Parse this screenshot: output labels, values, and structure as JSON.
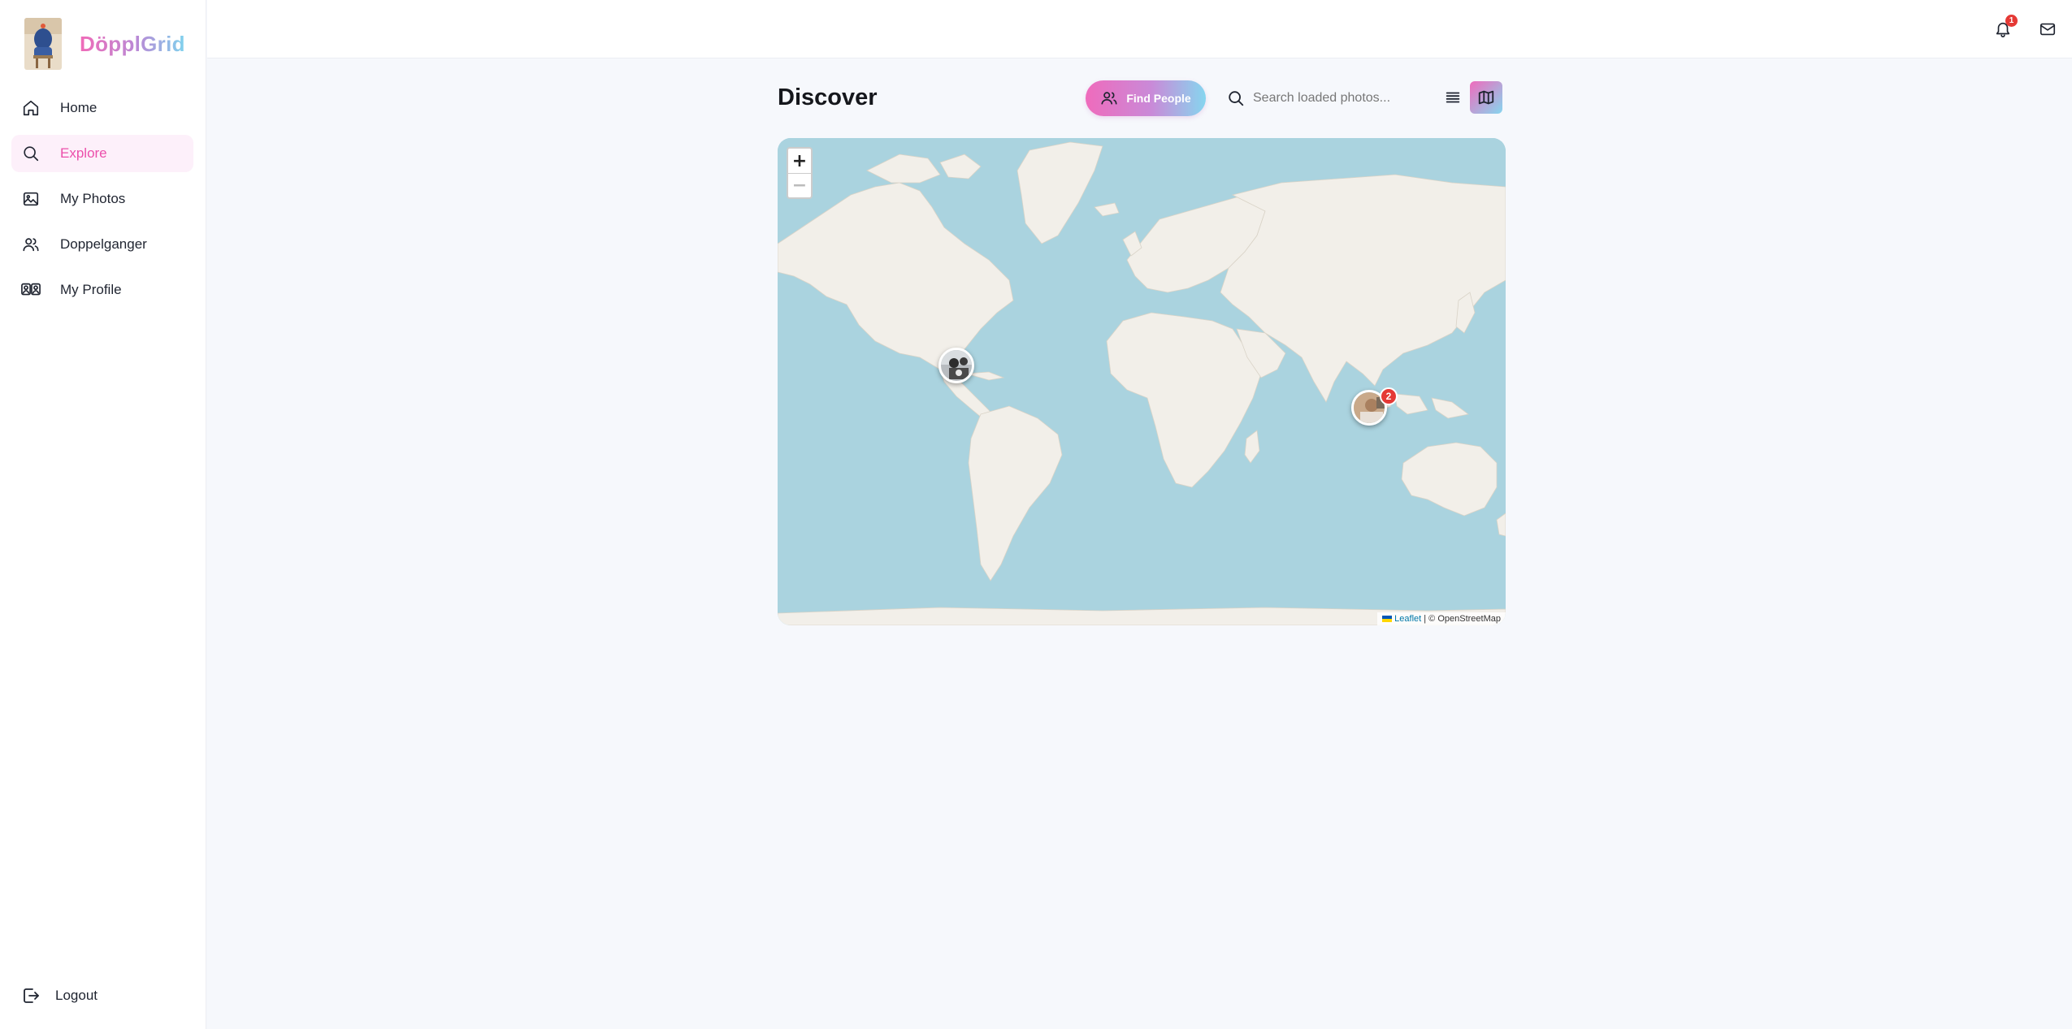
{
  "app": {
    "name": "DöpplGrid"
  },
  "sidebar": {
    "items": [
      {
        "label": "Home",
        "icon": "home-icon"
      },
      {
        "label": "Explore",
        "icon": "search-icon",
        "active": true
      },
      {
        "label": "My Photos",
        "icon": "image-icon"
      },
      {
        "label": "Doppelganger",
        "icon": "users-icon"
      },
      {
        "label": "My Profile",
        "icon": "profile-icon"
      }
    ],
    "logout_label": "Logout"
  },
  "topbar": {
    "notification_count": "1",
    "icons": [
      "bell-icon",
      "mail-icon"
    ]
  },
  "main": {
    "title": "Discover",
    "find_people_label": "Find People",
    "search_placeholder": "Search loaded photos...",
    "view_modes": [
      "list-view-icon",
      "map-view-icon"
    ],
    "active_view": "map"
  },
  "map": {
    "zoom_in": "+",
    "zoom_out": "−",
    "attribution_leaflet": "Leaflet",
    "attribution_separator": " | © ",
    "attribution_osm": "OpenStreetMap",
    "markers": [
      {
        "location": "Gulf of Mexico",
        "count": null
      },
      {
        "location": "Southeast Asia",
        "count": "2"
      }
    ]
  },
  "colors": {
    "accent_pink": "#ec4fab",
    "gradient_start": "#ef6bbc",
    "gradient_end": "#86d6ef",
    "water": "#aad3df",
    "land": "#f2efe9",
    "badge": "#e53935"
  }
}
